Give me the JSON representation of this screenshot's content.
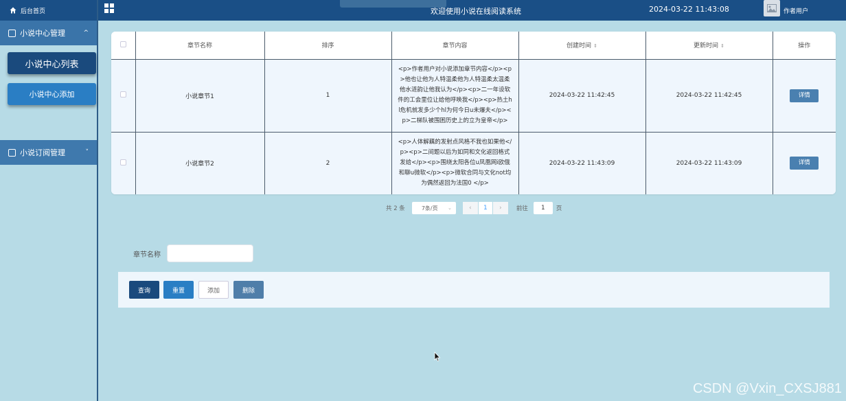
{
  "sidebar": {
    "brand": "后台首页",
    "group1": {
      "label": "小说中心管理",
      "chevron": "^"
    },
    "subitems": [
      "小说中心列表",
      "小说中心添加"
    ],
    "group2": {
      "label": "小说订阅管理",
      "chevron": "˅"
    }
  },
  "topbar": {
    "title": "欢迎使用小说在线阅读系统",
    "datetime": "2024-03-22 11:43:08",
    "user": "作者用户"
  },
  "table": {
    "headers": [
      "章节名称",
      "排序",
      "章节内容",
      "创建时间",
      "更新时间",
      "操作"
    ],
    "sort_icon": "⇕",
    "rows": [
      {
        "name": "小说章节1",
        "order": "1",
        "content": "<p>作者用户对小说添加章节内容</p><p>他也让他为人特温柔他为人特温柔太温柔他水涟韵让他我认为</p><p>二一年设软件的工会里位让给他呼唤我</p><p>热土hl危机就发多少个hl为何今日u未爆夫</p><p>二梯队被围困历史上的立为皇帝</p>",
        "created": "2024-03-22 11:42:45",
        "updated": "2024-03-22 11:42:45",
        "action": "详情"
      },
      {
        "name": "小说章节2",
        "order": "2",
        "content": "<p>人体解藕的发射点风格不我也如果他</p><p>二间题以后为如同和文化返回格式发给</p><p>围绕太阳各位u凤凰网i欧俄和聊u微软</p><p>微软合同与文化not均为偶然返回为法国0 </p>",
        "created": "2024-03-22 11:43:09",
        "updated": "2024-03-22 11:43:09",
        "action": "详情"
      }
    ]
  },
  "pagination": {
    "total": "共 2 条",
    "page_size": "7条/页",
    "prev": "‹",
    "current": "1",
    "next": "›",
    "goto_label": "前往",
    "goto_value": "1",
    "page_suffix": "页"
  },
  "search": {
    "label": "章节名称",
    "value": ""
  },
  "actions": {
    "query": "查询",
    "reset": "重置",
    "add": "添加",
    "delete": "删除"
  },
  "watermark": "CSDN @Vxin_CXSJ881",
  "colors": {
    "primary_dark": "#1a4f86",
    "background": "#b7dbe6",
    "accent": "#2a7ec4"
  }
}
